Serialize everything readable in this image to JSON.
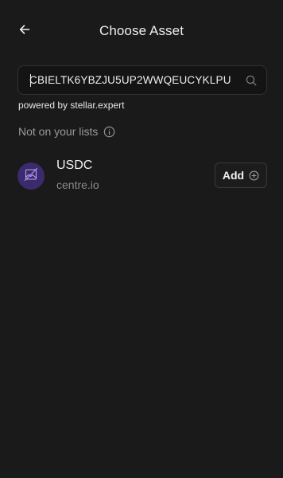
{
  "header": {
    "title": "Choose Asset",
    "back_icon": "arrow-left-icon"
  },
  "search": {
    "value": "CBIELTK6YBZJU5UP2WWQEUCYKLPU",
    "placeholder": "",
    "icon": "search-icon",
    "powered_by": "powered by stellar.expert"
  },
  "section": {
    "label": "Not on your lists",
    "icon": "info-icon"
  },
  "assets": [
    {
      "code": "USDC",
      "domain": "centre.io",
      "avatar_icon": "image-placeholder-icon",
      "action_label": "Add",
      "action_icon": "plus-circle-icon"
    }
  ],
  "colors": {
    "background": "#1a1a1a",
    "avatar_bg": "#3b2a6e",
    "muted_text": "#9a9a9a"
  }
}
